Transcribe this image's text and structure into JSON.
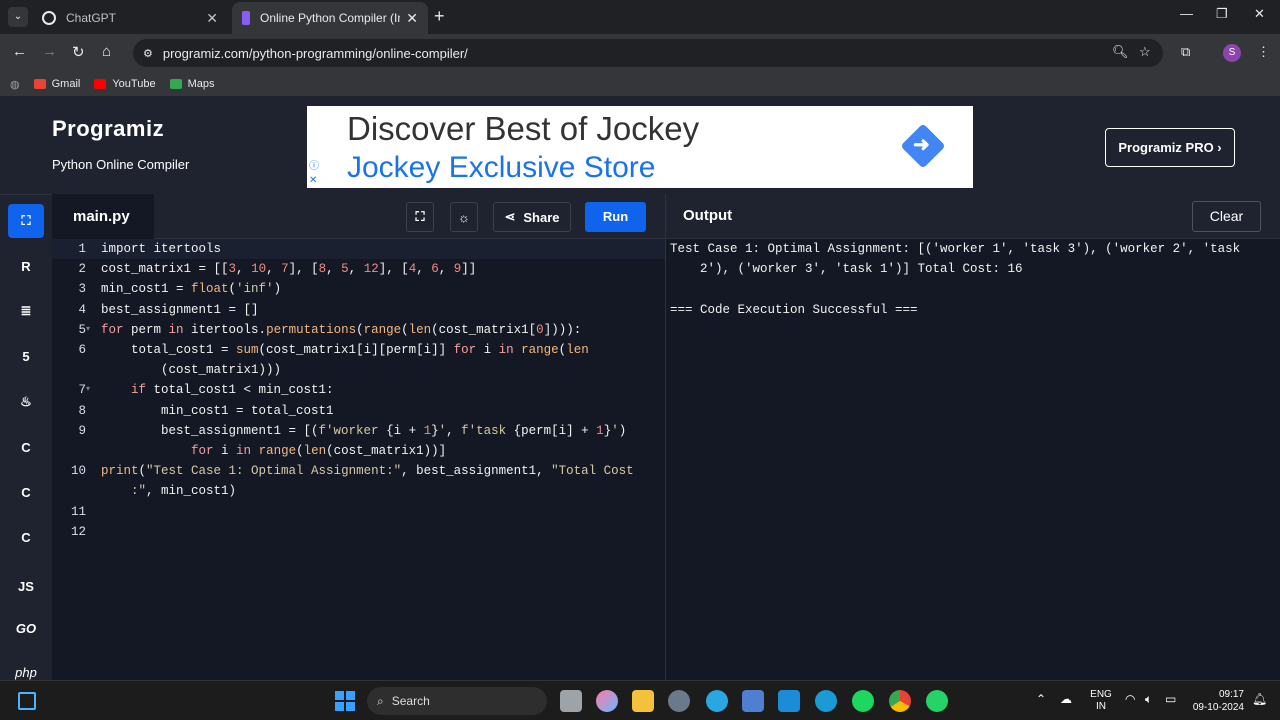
{
  "browser": {
    "tabs": [
      {
        "title": "ChatGPT",
        "favicon_color": "#e8eaed"
      },
      {
        "title": "Online Python Compiler (Interp",
        "favicon_color": "#8a5cf6"
      }
    ],
    "url": "programiz.com/python-programming/online-compiler/",
    "bookmarks": [
      {
        "label": "Gmail",
        "color": "#ea4335"
      },
      {
        "label": "YouTube",
        "color": "#ff0000"
      },
      {
        "label": "Maps",
        "color": "#34a853"
      }
    ],
    "profile_initial": "S"
  },
  "header": {
    "logo": "Programiz",
    "subtitle": "Python Online Compiler",
    "ad_line1": "Discover Best of Jockey",
    "ad_line2": "Jockey Exclusive Store",
    "pro_button": "Programiz PRO ›"
  },
  "sidebar": {
    "languages": [
      {
        "name": "python",
        "glyph": "🐍",
        "active": true
      },
      {
        "name": "r",
        "glyph": "R"
      },
      {
        "name": "sql",
        "glyph": "≣"
      },
      {
        "name": "html",
        "glyph": "5"
      },
      {
        "name": "java",
        "glyph": "♨"
      },
      {
        "name": "c",
        "glyph": "C"
      },
      {
        "name": "cpp",
        "glyph": "C"
      },
      {
        "name": "csharp",
        "glyph": "C"
      },
      {
        "name": "js",
        "glyph": "JS"
      },
      {
        "name": "go",
        "glyph": "GO"
      },
      {
        "name": "php",
        "glyph": "php"
      }
    ]
  },
  "editor": {
    "filename": "main.py",
    "share_label": "Share",
    "run_label": "Run",
    "lines": [
      {
        "n": "1",
        "html": "import itertools"
      },
      {
        "n": "2",
        "html": "cost_matrix1 = [[<n>3</n>, <n>10</n>, <n>7</n>], [<n>8</n>, <n>5</n>, <n>12</n>], [<n>4</n>, <n>6</n>, <n>9</n>]]"
      },
      {
        "n": "3",
        "html": "min_cost1 = <f>float</f>(<s>'inf'</s>)"
      },
      {
        "n": "4",
        "html": "best_assignment1 = []"
      },
      {
        "n": "5",
        "fold": true,
        "html": "<k>for</k> perm <k>in</k> itertools.<f>permutations</f>(<f>range</f>(<f>len</f>(cost_matrix1[<n>0</n>]))):"
      },
      {
        "n": "6",
        "html": "    total_cost1 = <f>sum</f>(cost_matrix1[i][perm[i]] <k>for</k> i <k>in</k> <f>range</f>(<f>len</f>"
      },
      {
        "n": "",
        "html": "        (cost_matrix1)))"
      },
      {
        "n": "7",
        "fold": true,
        "html": "    <k>if</k> total_cost1 &lt; min_cost1:"
      },
      {
        "n": "8",
        "html": "        min_cost1 = total_cost1"
      },
      {
        "n": "9",
        "html": "        best_assignment1 = [(<s>f'worker </s>{i + <n>1</n>}<s>'</s>, <s>f'task </s>{perm[i] + <n>1</n>}<s>'</s>)"
      },
      {
        "n": "",
        "html": "            <k>for</k> i <k>in</k> <f>range</f>(<f>len</f>(cost_matrix1))]"
      },
      {
        "n": "10",
        "html": "<f>print</f>(<s>\"Test Case 1: Optimal Assignment:\"</s>, best_assignment1, <s>\"Total Cost</s>"
      },
      {
        "n": "",
        "html": "    <s>:\"</s>, min_cost1)"
      },
      {
        "n": "11",
        "html": ""
      },
      {
        "n": "12",
        "html": ""
      }
    ]
  },
  "output": {
    "title": "Output",
    "clear_label": "Clear",
    "lines": [
      "Test Case 1: Optimal Assignment: [('worker 1', 'task 3'), ('worker 2', 'task",
      "    2'), ('worker 3', 'task 1')] Total Cost: 16",
      "",
      "=== Code Execution Successful ==="
    ]
  },
  "taskbar": {
    "search_placeholder": "Search",
    "lang_line1": "ENG",
    "lang_line2": "IN",
    "time": "09:17",
    "date": "09-10-2024"
  }
}
